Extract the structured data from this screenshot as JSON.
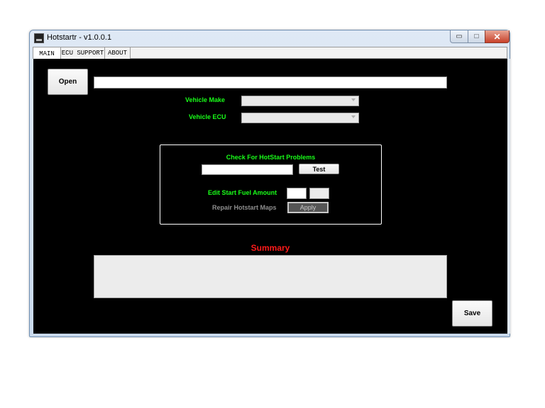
{
  "window": {
    "title": "Hotstartr - v1.0.0.1",
    "close_glyph": "✕",
    "min_glyph": "▭",
    "max_glyph": "□"
  },
  "tabs": [
    {
      "label": "MAIN",
      "active": true
    },
    {
      "label": "ECU SUPPORT",
      "active": false
    },
    {
      "label": "ABOUT",
      "active": false
    }
  ],
  "file": {
    "open_label": "Open",
    "path_value": ""
  },
  "vehicle": {
    "make_label": "Vehicle Make",
    "make_value": "",
    "ecu_label": "Vehicle ECU",
    "ecu_value": ""
  },
  "hotstart": {
    "check_label": "Check For HotStart Problems",
    "check_value": "",
    "test_label": "Test",
    "fuel_label": "Edit Start Fuel Amount",
    "fuel_value_1": "",
    "fuel_value_2": "",
    "repair_label": "Repair Hotstart Maps",
    "apply_label": "Apply"
  },
  "summary": {
    "title": "Summary",
    "text": ""
  },
  "save_label": "Save",
  "colors": {
    "background": "#000000",
    "label_green": "#19ff19",
    "summary_red": "#ff1a1a",
    "disabled_grey": "#8e8e8e"
  }
}
